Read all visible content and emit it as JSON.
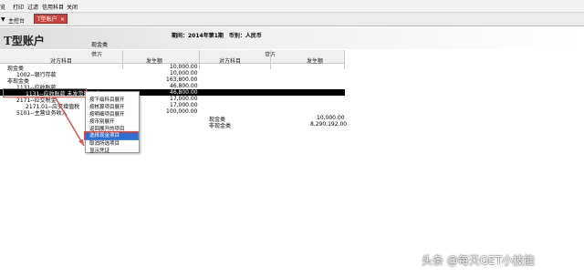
{
  "menubar": {
    "items": [
      "览",
      "打印",
      "过滤",
      "信用科目",
      "关闭"
    ]
  },
  "tabs": {
    "arrow": "▼",
    "home": "主控台",
    "active": "T型账户",
    "close": "×"
  },
  "header": {
    "title": "T型账户",
    "info": "期间：2014年第1期　币别：人民币",
    "account": "现金类"
  },
  "columns": {
    "debit": "借方",
    "credit": "贷方",
    "counter_account": "对方科目",
    "amount": "发生额"
  },
  "rows": [
    {
      "left": "现金类",
      "amount": "10,000.00",
      "right": "",
      "ramount": ""
    },
    {
      "left": "1002--银行存款",
      "amount": "10,000.00",
      "right": "",
      "ramount": ""
    },
    {
      "left": "非现金类",
      "amount": "163,800.00",
      "right": "",
      "ramount": ""
    },
    {
      "left": "1131--应收账款",
      "amount": "46,800.00",
      "right": "",
      "ramount": ""
    },
    {
      "left": "1131--应收账款 未发货的产成品",
      "amount": "46,800.00",
      "right": "",
      "ramount": ""
    },
    {
      "left": "2171--应交税金",
      "amount": "17,000.00",
      "right": "",
      "ramount": ""
    },
    {
      "left": "2171.01--应交增值税",
      "amount": "17,000.00",
      "right": "",
      "ramount": ""
    },
    {
      "left": "5101--主营业务收入",
      "amount": "100,000.00",
      "right": "",
      "ramount": ""
    },
    {
      "left": "",
      "amount": "",
      "right": "现金类",
      "ramount": "10,000.00"
    },
    {
      "left": "",
      "amount": "",
      "right": "非现金类",
      "ramount": "8,290,192.00"
    }
  ],
  "context_menu": {
    "items": [
      "按下级科目展开",
      "按核算项目展开",
      "按明细项目展开",
      "按币别展开",
      "返回展开的项目",
      "选择现金项目",
      "取消所选项目",
      "显示凭证"
    ],
    "selected_index": 5
  },
  "watermark": "头条 @每天GET小技能"
}
